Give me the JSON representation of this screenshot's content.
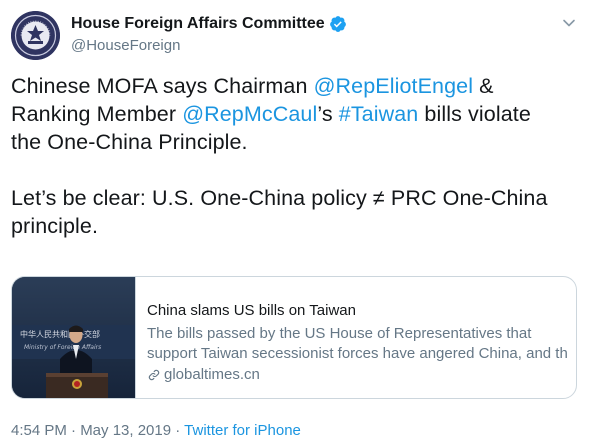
{
  "author": {
    "display_name": "House Foreign Affairs Committee",
    "handle": "@HouseForeign",
    "verified": true
  },
  "tweet": {
    "line1_prefix": "Chinese MOFA says Chairman ",
    "mention1": "@RepEliotEngel",
    "line1_suffix": " &",
    "line2_prefix": "Ranking Member ",
    "mention2": "@RepMcCaul",
    "line2_mid": "’s ",
    "hashtag": "#Taiwan",
    "line2_suffix": " bills violate",
    "line3": "the One-China Principle.",
    "line4": "Let’s be clear: U.S. One-China policy ≠ PRC One-China",
    "line5": "principle."
  },
  "card": {
    "title": "China slams US bills on Taiwan",
    "description_line1": "The bills passed by the US House of Representatives that",
    "description_line2": "support Taiwan secessionist forces have angered China, and th...",
    "domain": "globaltimes.cn",
    "image_sign_line1": "中华人民共和国外交部",
    "image_sign_line2": "Ministry of Foreign Affairs"
  },
  "meta": {
    "time": "4:54 PM · May 13, 2019 · ",
    "source": "Twitter for iPhone"
  },
  "colors": {
    "link": "#1b95e0",
    "secondary_text": "#657786",
    "border": "#ccd6dd",
    "verified": "#1da1f2"
  },
  "icons": [
    "committee-seal-icon",
    "verified-badge-icon",
    "chevron-down-icon",
    "link-icon"
  ]
}
